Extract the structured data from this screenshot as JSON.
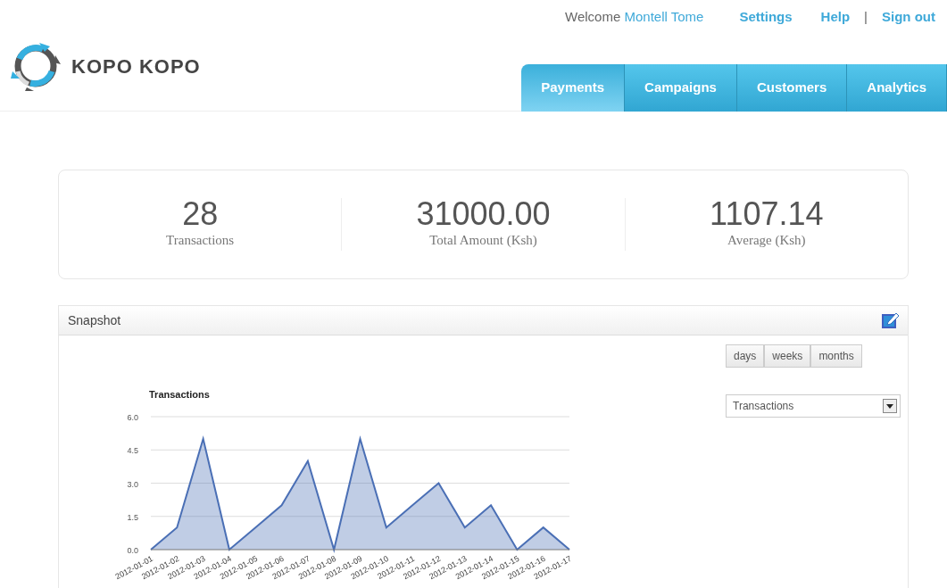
{
  "top_links": {
    "welcome": "Welcome",
    "user": "Montell Tome",
    "settings": "Settings",
    "help": "Help",
    "separator": "|",
    "sign_out": "Sign out"
  },
  "logo": {
    "text": "KOPO KOPO"
  },
  "tabs": [
    {
      "label": "Payments",
      "selected": true
    },
    {
      "label": "Campaigns",
      "selected": false
    },
    {
      "label": "Customers",
      "selected": false
    },
    {
      "label": "Analytics",
      "selected": false
    }
  ],
  "stats": [
    {
      "value": "28",
      "label": "Transactions"
    },
    {
      "value": "31000.00",
      "label": "Total Amount (Ksh)"
    },
    {
      "value": "1107.14",
      "label": "Average (Ksh)"
    }
  ],
  "snapshot": {
    "title": "Snapshot",
    "periods": [
      {
        "label": "days",
        "selected": false
      },
      {
        "label": "weeks",
        "selected": false
      },
      {
        "label": "months",
        "selected": false
      }
    ],
    "metric_select": {
      "value": "Transactions"
    },
    "chart_data": {
      "type": "area",
      "title": "Transactions",
      "categories": [
        "2012-01-01",
        "2012-01-02",
        "2012-01-03",
        "2012-01-04",
        "2012-01-05",
        "2012-01-06",
        "2012-01-07",
        "2012-01-08",
        "2012-01-09",
        "2012-01-10",
        "2012-01-11",
        "2012-01-12",
        "2012-01-13",
        "2012-01-14",
        "2012-01-15",
        "2012-01-16",
        "2012-01-17"
      ],
      "grid": true,
      "series": [
        {
          "color": "#4a6fb5",
          "values": [
            0,
            1,
            5,
            0,
            1,
            2,
            4,
            0,
            5,
            1,
            2,
            3,
            1,
            2,
            0,
            1,
            0
          ]
        }
      ],
      "ylim": [
        0,
        6
      ],
      "yticks": [
        {
          "value": 0,
          "label": "0.0"
        },
        {
          "value": 1.5,
          "label": "1.5"
        },
        {
          "value": 3,
          "label": "3.0"
        },
        {
          "value": 4.5,
          "label": "4.5"
        },
        {
          "value": 6,
          "label": "6.0"
        }
      ]
    }
  }
}
